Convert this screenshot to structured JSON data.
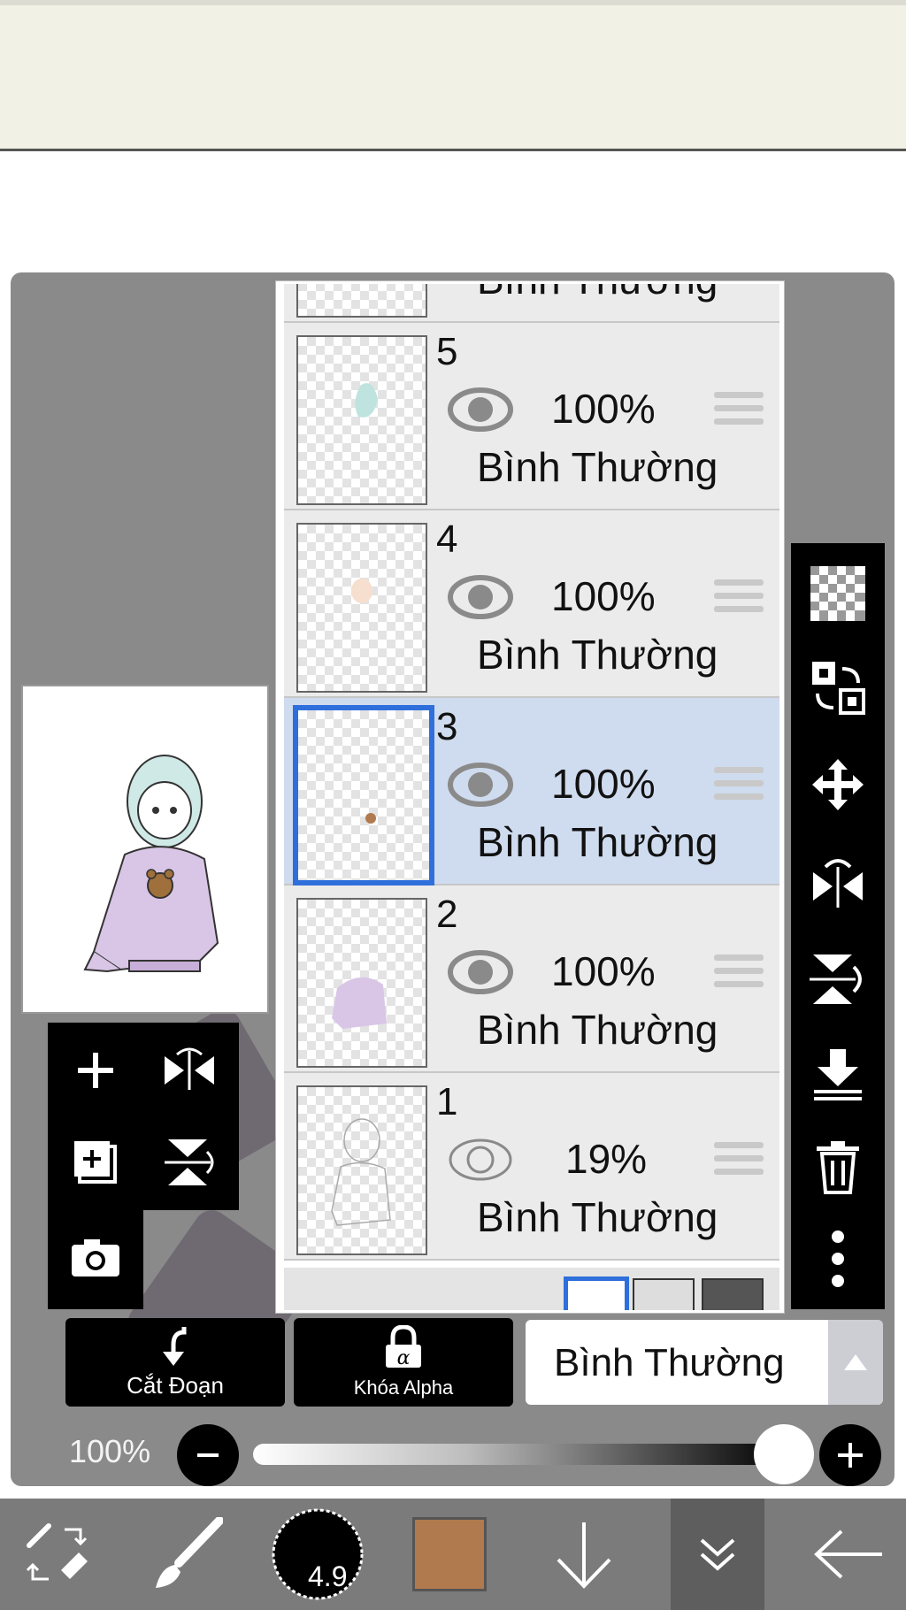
{
  "layers": [
    {
      "number": "5",
      "opacity": "100%",
      "mode": "Bình Thường",
      "visible": true
    },
    {
      "number": "4",
      "opacity": "100%",
      "mode": "Bình Thường",
      "visible": true
    },
    {
      "number": "3",
      "opacity": "100%",
      "mode": "Bình Thường",
      "visible": true,
      "selected": true
    },
    {
      "number": "2",
      "opacity": "100%",
      "mode": "Bình Thường",
      "visible": true
    },
    {
      "number": "1",
      "opacity": "19%",
      "mode": "Bình Thường",
      "visible": false
    }
  ],
  "partial_top_layer_mode": "Bình Thường",
  "layer_actions": {
    "clipping_label": "Cắt Đoạn",
    "alpha_lock_label": "Khóa Alpha",
    "blend_mode": "Bình Thường"
  },
  "opacity_control": {
    "label": "100%",
    "value": 1.0
  },
  "brush": {
    "size_label": "4.9",
    "color": "#b07a4e"
  },
  "colors": {
    "selection_border": "#2e6fdc",
    "selected_row": "#cfdbee",
    "row_bg": "#ebebeb",
    "toolbar_bg": "#7b7b7b"
  }
}
